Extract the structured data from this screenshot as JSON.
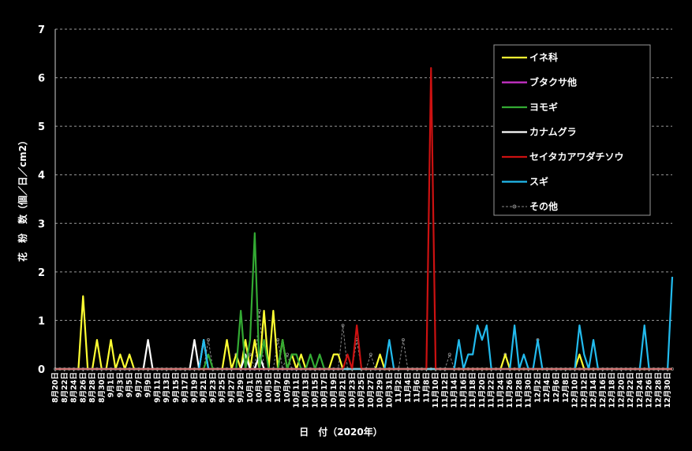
{
  "chart_data": {
    "type": "line",
    "xlabel": "日　付（2020年）",
    "ylabel": "花　粉　数（個／日／cm2）",
    "ylim": [
      0,
      7
    ],
    "yticks": [
      0,
      1,
      2,
      3,
      4,
      5,
      6,
      7
    ],
    "grid": "horizontal-dashed",
    "legend_position": "top-right",
    "x_start": "8月20日",
    "x_end": "12月31日",
    "x_tick_labels": [
      "8月20日",
      "8月22日",
      "8月24日",
      "8月26日",
      "8月28日",
      "8月30日",
      "9月1日",
      "9月3日",
      "9月5日",
      "9月7日",
      "9月9日",
      "9月11日",
      "9月13日",
      "9月15日",
      "9月17日",
      "9月19日",
      "9月21日",
      "9月23日",
      "9月25日",
      "9月27日",
      "9月29日",
      "10月1日",
      "10月3日",
      "10月5日",
      "10月7日",
      "10月9日",
      "10月11日",
      "10月13日",
      "10月15日",
      "10月17日",
      "10月19日",
      "10月21日",
      "10月23日",
      "10月25日",
      "10月27日",
      "10月29日",
      "10月31日",
      "11月2日",
      "11月4日",
      "11月6日",
      "11月8日",
      "11月10日",
      "11月12日",
      "11月14日",
      "11月16日",
      "11月18日",
      "11月20日",
      "11月22日",
      "11月24日",
      "11月26日",
      "11月28日",
      "11月30日",
      "12月2日",
      "12月4日",
      "12月6日",
      "12月8日",
      "12月10日",
      "12月12日",
      "12月14日",
      "12月16日",
      "12月18日",
      "12月20日",
      "12月22日",
      "12月24日",
      "12月26日",
      "12月28日",
      "12月30日"
    ],
    "series": [
      {
        "name": "イネ科",
        "color": "#ffff33",
        "style": "solid",
        "points": [
          [
            "8月26日",
            1.5
          ],
          [
            "8月29日",
            0.6
          ],
          [
            "9月1日",
            0.6
          ],
          [
            "9月3日",
            0.3
          ],
          [
            "9月5日",
            0.3
          ],
          [
            "9月26日",
            0.6
          ],
          [
            "9月28日",
            0.3
          ],
          [
            "9月30日",
            0.6
          ],
          [
            "10月2日",
            0.6
          ],
          [
            "10月4日",
            1.2
          ],
          [
            "10月6日",
            1.2
          ],
          [
            "10月8日",
            0.6
          ],
          [
            "10月10日",
            0.3
          ],
          [
            "10月12日",
            0.3
          ],
          [
            "10月19日",
            0.3
          ],
          [
            "10月20日",
            0.3
          ],
          [
            "10月29日",
            0.3
          ],
          [
            "11月25日",
            0.3
          ],
          [
            "12月11日",
            0.3
          ]
        ]
      },
      {
        "name": "ブタクサ他",
        "color": "#cc33cc",
        "style": "solid",
        "points": []
      },
      {
        "name": "ヨモギ",
        "color": "#33aa33",
        "style": "solid",
        "points": [
          [
            "9月22日",
            0.3
          ],
          [
            "9月29日",
            1.2
          ],
          [
            "10月1日",
            0.6
          ],
          [
            "10月2日",
            2.8
          ],
          [
            "10月4日",
            0.6
          ],
          [
            "10月8日",
            0.6
          ],
          [
            "10月10日",
            0.3
          ],
          [
            "10月11日",
            0.3
          ],
          [
            "10月14日",
            0.3
          ],
          [
            "10月16日",
            0.3
          ]
        ]
      },
      {
        "name": "カナムグラ",
        "color": "#ffffff",
        "style": "solid",
        "points": [
          [
            "9月9日",
            0.6
          ],
          [
            "9月19日",
            0.6
          ],
          [
            "9月21日",
            0.6
          ],
          [
            "9月30日",
            0.3
          ],
          [
            "10月3日",
            0.3
          ]
        ]
      },
      {
        "name": "セイタカアワダチソウ",
        "color": "#cc1111",
        "style": "solid",
        "points": [
          [
            "10月22日",
            0.3
          ],
          [
            "10月24日",
            0.9
          ],
          [
            "11月9日",
            6.2
          ]
        ]
      },
      {
        "name": "スギ",
        "color": "#22bbee",
        "style": "solid",
        "points": [
          [
            "9月21日",
            0.6
          ],
          [
            "10月31日",
            0.6
          ],
          [
            "11月15日",
            0.6
          ],
          [
            "11月17日",
            0.3
          ],
          [
            "11月18日",
            0.3
          ],
          [
            "11月19日",
            0.9
          ],
          [
            "11月20日",
            0.6
          ],
          [
            "11月21日",
            0.9
          ],
          [
            "11月27日",
            0.9
          ],
          [
            "11月29日",
            0.3
          ],
          [
            "12月2日",
            0.6
          ],
          [
            "12月11日",
            0.9
          ],
          [
            "12月12日",
            0.3
          ],
          [
            "12月14日",
            0.6
          ],
          [
            "12月25日",
            0.9
          ],
          [
            "12月31日",
            1.9
          ]
        ]
      },
      {
        "name": "その他",
        "color": "#888888",
        "style": "dashed-marker",
        "points": [
          [
            "9月22日",
            0.6
          ],
          [
            "9月28日",
            0.3
          ],
          [
            "10月1日",
            0.3
          ],
          [
            "10月3日",
            1.2
          ],
          [
            "10月7日",
            0.6
          ],
          [
            "10月9日",
            0.3
          ],
          [
            "10月21日",
            0.9
          ],
          [
            "10月24日",
            0.6
          ],
          [
            "10月27日",
            0.3
          ],
          [
            "11月3日",
            0.6
          ],
          [
            "11月13日",
            0.3
          ],
          [
            "11月25日",
            0.3
          ],
          [
            "12月2日",
            0.6
          ]
        ]
      }
    ]
  }
}
